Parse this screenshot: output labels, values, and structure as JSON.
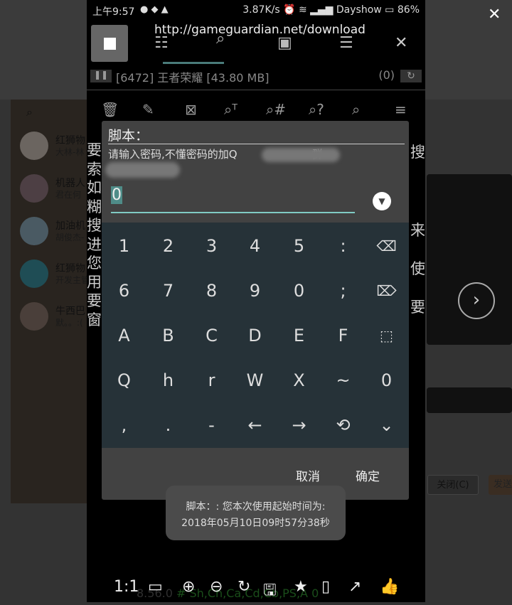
{
  "viewer": {
    "close_icon": "close-icon",
    "next_icon": "chevron-right-icon",
    "close_label": "关闭(C)",
    "send_label": "发送"
  },
  "chat_list": [
    {
      "name": "红狮物",
      "sub": "大林-林"
    },
    {
      "name": "机器人",
      "sub": "君在何"
    },
    {
      "name": "加油机",
      "sub": "胡俊杰-"
    },
    {
      "name": "红狮物",
      "sub": "开发主管"
    },
    {
      "name": "牛西巴",
      "sub": "默。。:("
    }
  ],
  "side_text_left": [
    "要",
    "索",
    "如",
    "糊",
    "搜",
    "进",
    "您",
    "用",
    "要",
    "窗"
  ],
  "side_text_right": [
    "搜",
    "来",
    "使",
    "要"
  ],
  "status_bar": {
    "time": "上午9:57",
    "speed": "3.87K/s",
    "carrier": "Dayshow",
    "battery": "86%"
  },
  "gg": {
    "url": "http://gameguardian.net/download",
    "process": "[6472] 王者荣耀 [43.80 MB]",
    "count": "(0)",
    "version": "8.56.0",
    "flags": "# Sh,Ch,Ca,Cd,Cb,PS,A 0"
  },
  "dialog": {
    "title": "脚本：",
    "message": "请输入密码,不懂密码的加Q",
    "message_end": "群",
    "input_value": "0",
    "cancel": "取消",
    "ok": "确定"
  },
  "keyboard": [
    [
      "1",
      "2",
      "3",
      "4",
      "5",
      ":",
      "⌫"
    ],
    [
      "6",
      "7",
      "8",
      "9",
      "0",
      ";",
      "⌦"
    ],
    [
      "A",
      "B",
      "C",
      "D",
      "E",
      "F",
      "⬚"
    ],
    [
      "Q",
      "h",
      "r",
      "W",
      "X",
      "~",
      "0"
    ],
    [
      ",",
      ".",
      "-",
      "←",
      "→",
      "⟲",
      "⌄"
    ]
  ],
  "toast": {
    "line1": "脚本：: 您本次使用起始时间为:",
    "line2": "2018年05月10日09时57分38秒"
  },
  "bottom_bar": {
    "ratio": "1:1"
  }
}
